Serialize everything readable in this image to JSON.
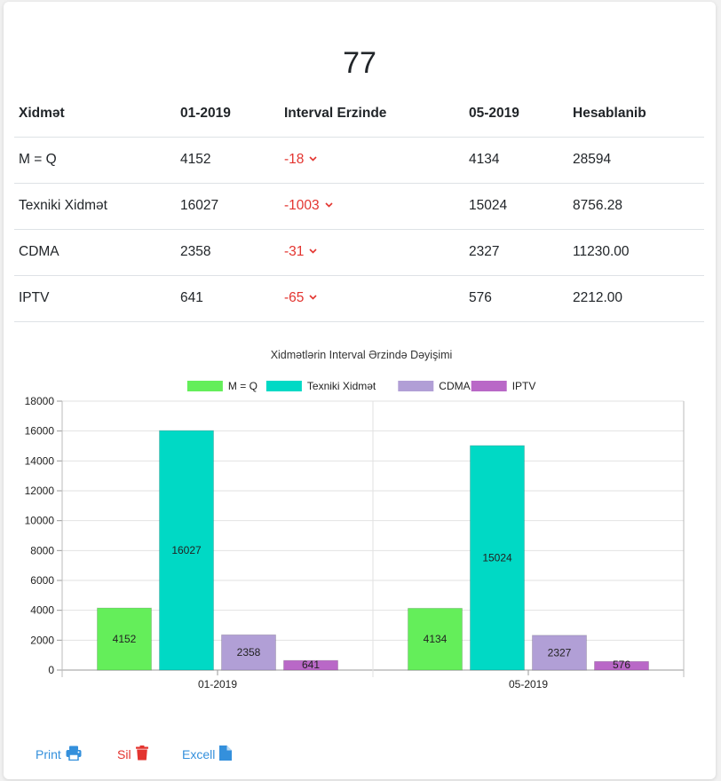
{
  "summary": {
    "value": "77"
  },
  "table": {
    "headers": [
      "Xidmət",
      "01-2019",
      "Interval Erzinde",
      "05-2019",
      "Hesablanib"
    ],
    "rows": [
      {
        "service": "M = Q",
        "start": "4152",
        "delta": "-18",
        "end": "4134",
        "calc": "28594"
      },
      {
        "service": "Texniki Xidmət",
        "start": "16027",
        "delta": "-1003",
        "end": "15024",
        "calc": "8756.28"
      },
      {
        "service": "CDMA",
        "start": "2358",
        "delta": "-31",
        "end": "2327",
        "calc": "11230.00"
      },
      {
        "service": "IPTV",
        "start": "641",
        "delta": "-65",
        "end": "576",
        "calc": "2212.00"
      }
    ],
    "delta_icon": "chevron-down-icon"
  },
  "chart_data": {
    "type": "bar",
    "title": "Xidmətlərin Interval Ərzində Dəyişimi",
    "categories": [
      "01-2019",
      "05-2019"
    ],
    "series": [
      {
        "name": "M = Q",
        "color": "#64ee5a",
        "values": [
          4152,
          4134
        ]
      },
      {
        "name": "Texniki Xidmət",
        "color": "#00d9c5",
        "values": [
          16027,
          15024
        ]
      },
      {
        "name": "CDMA",
        "color": "#b19fd6",
        "values": [
          2358,
          2327
        ]
      },
      {
        "name": "IPTV",
        "color": "#b968c7",
        "values": [
          641,
          576
        ]
      }
    ],
    "ylim": [
      0,
      18000
    ],
    "yticks": [
      0,
      2000,
      4000,
      6000,
      8000,
      10000,
      12000,
      14000,
      16000,
      18000
    ],
    "grid": true,
    "legend": "top-center",
    "data_labels": true
  },
  "actions": {
    "print": {
      "label": "Print",
      "icon": "printer-icon",
      "color": "#3490dc"
    },
    "delete": {
      "label": "Sil",
      "icon": "trash-icon",
      "color": "#e3342f"
    },
    "excel": {
      "label": "Excell",
      "icon": "file-icon",
      "color": "#3490dc"
    }
  }
}
